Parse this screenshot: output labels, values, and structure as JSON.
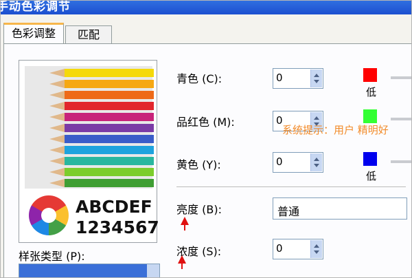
{
  "window": {
    "title": "手动色彩调节"
  },
  "tabs": [
    {
      "label": "色彩调整",
      "active": true
    },
    {
      "label": "匹配",
      "active": false
    }
  ],
  "preview": {
    "line1": "ABCDEF",
    "line2": "1234567"
  },
  "controls": {
    "cyan": {
      "label": "青色",
      "hotkey": "(C)",
      "value": "0",
      "swatch": "#ff0000",
      "low_label": "低"
    },
    "magenta": {
      "label": "品红色",
      "hotkey": "(M)",
      "value": "0",
      "swatch": "#33ff33"
    },
    "yellow": {
      "label": "黄色",
      "hotkey": "(Y)",
      "value": "0",
      "swatch": "#0000ee",
      "low_label": "低"
    },
    "brightness": {
      "label": "亮度",
      "hotkey": "(B)",
      "value": "普通"
    },
    "saturation": {
      "label": "浓度",
      "hotkey": "(S)",
      "value": "0"
    }
  },
  "paper_type": {
    "label": "样张类型",
    "hotkey": "(P)"
  },
  "tooltip": {
    "text": "系统提示：用户 精明好"
  },
  "colors": {
    "accent_arrow": "#e01010",
    "titlebar": "#1c4fd0"
  }
}
